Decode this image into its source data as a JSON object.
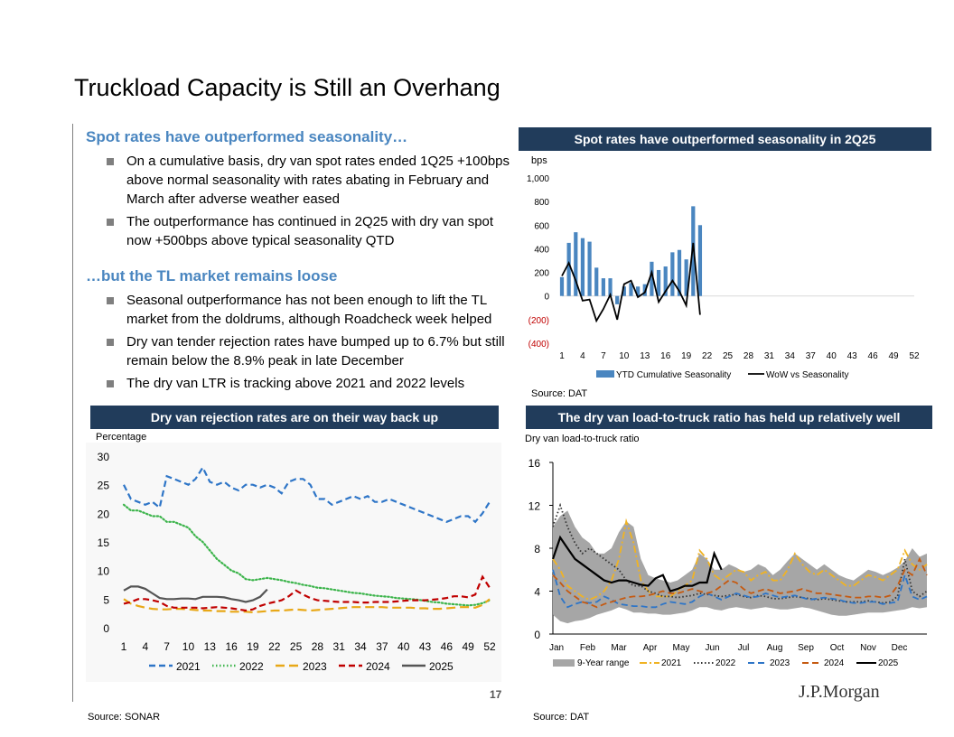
{
  "page": {
    "title": "Truckload Capacity is Still an Overhang",
    "page_number": "17",
    "logo": "J.P.Morgan"
  },
  "left": {
    "section1_heading": "Spot rates have outperformed seasonality…",
    "section1_bullets": [
      "On a cumulative basis, dry van spot rates ended 1Q25 +100bps above normal seasonality with rates abating in February and March after adverse weather eased",
      "The outperformance has continued in 2Q25 with dry van spot now +500bps above typical seasonality QTD"
    ],
    "section2_heading": "…but the TL market remains loose",
    "section2_bullets": [
      "Seasonal outperformance has not been enough to lift the TL market from the doldrums, although Roadcheck week helped",
      "Dry van tender rejection rates have bumped up to 6.7% but still remain below the 8.9% peak in late December",
      "The dry van LTR is tracking above 2021 and 2022 levels"
    ]
  },
  "chart_data": [
    {
      "id": "spot",
      "type": "bar",
      "title": "Spot rates have outperformed seasonality in 2Q25",
      "ylabel": "bps",
      "ylim": [
        -400,
        1000
      ],
      "yticks": [
        1000,
        800,
        600,
        400,
        200,
        0,
        -200,
        -400
      ],
      "ytick_labels": [
        "1,000",
        "800",
        "600",
        "400",
        "200",
        "0",
        "(200)",
        "(400)"
      ],
      "negative_tick_color": "#c00000",
      "x": [
        1,
        2,
        3,
        4,
        5,
        6,
        7,
        8,
        9,
        10,
        11,
        12,
        13,
        14,
        15,
        16,
        17,
        18,
        19,
        20,
        21
      ],
      "xticks": [
        1,
        4,
        7,
        10,
        13,
        16,
        19,
        22,
        25,
        28,
        31,
        34,
        37,
        40,
        43,
        46,
        49,
        52
      ],
      "xlim": [
        1,
        52
      ],
      "source": "Source: DAT",
      "series": [
        {
          "name": "YTD Cumulative Seasonality",
          "kind": "bar",
          "color": "#4a86c0",
          "values": [
            160,
            450,
            540,
            490,
            460,
            240,
            150,
            150,
            -70,
            80,
            110,
            80,
            100,
            290,
            220,
            250,
            370,
            390,
            310,
            760,
            600
          ]
        },
        {
          "name": "WoW vs Seasonality",
          "kind": "line",
          "color": "#000000",
          "values": [
            170,
            280,
            130,
            -40,
            -30,
            -210,
            -110,
            10,
            -200,
            100,
            130,
            -10,
            30,
            200,
            -50,
            40,
            130,
            40,
            -80,
            450,
            -160
          ]
        }
      ]
    },
    {
      "id": "rejection",
      "type": "line",
      "title": "Dry van rejection rates are on their way back up",
      "ylabel": "Percentage",
      "ylim": [
        0,
        30
      ],
      "yticks": [
        0,
        5,
        10,
        15,
        20,
        25,
        30
      ],
      "xlim": [
        1,
        52
      ],
      "xticks": [
        1,
        4,
        7,
        10,
        13,
        16,
        19,
        22,
        25,
        28,
        31,
        34,
        37,
        40,
        43,
        46,
        49,
        52
      ],
      "source": "Source: SONAR",
      "series": [
        {
          "name": "2021",
          "color": "#2e75c7",
          "dash": "dash",
          "values": [
            25.0,
            22.5,
            22.0,
            21.5,
            22.0,
            21.0,
            26.5,
            26.0,
            25.5,
            25.0,
            26.0,
            28.0,
            25.5,
            25.0,
            25.5,
            24.5,
            24.0,
            25.0,
            25.0,
            24.5,
            25.0,
            24.5,
            23.5,
            25.5,
            26.0,
            26.0,
            25.0,
            22.5,
            22.5,
            21.5,
            22.0,
            22.5,
            23.0,
            22.5,
            23.0,
            22.0,
            22.0,
            22.5,
            22.0,
            21.5,
            21.0,
            20.5,
            20.0,
            19.5,
            19.0,
            18.5,
            19.0,
            19.5,
            19.5,
            18.5,
            20.0,
            22.0
          ]
        },
        {
          "name": "2022",
          "color": "#3cb44b",
          "dash": "dot",
          "values": [
            21.5,
            20.5,
            20.5,
            20.0,
            19.5,
            19.5,
            18.5,
            18.5,
            18.0,
            17.5,
            16.0,
            15.0,
            13.5,
            12.0,
            11.0,
            10.0,
            9.5,
            8.5,
            8.3,
            8.5,
            8.7,
            8.5,
            8.3,
            8.0,
            7.8,
            7.5,
            7.3,
            7.0,
            6.9,
            6.7,
            6.5,
            6.3,
            6.1,
            6.0,
            5.8,
            5.6,
            5.5,
            5.4,
            5.2,
            5.1,
            5.0,
            4.9,
            4.7,
            4.5,
            4.4,
            4.2,
            4.1,
            4.0,
            3.9,
            4.0,
            4.3,
            4.8
          ]
        },
        {
          "name": "2023",
          "color": "#e8a817",
          "dash": "longdash",
          "values": [
            5.0,
            4.2,
            3.8,
            3.5,
            3.3,
            3.2,
            3.2,
            3.3,
            3.3,
            3.2,
            3.1,
            3.0,
            3.0,
            2.9,
            2.9,
            2.8,
            2.8,
            2.8,
            2.7,
            2.8,
            2.9,
            3.0,
            3.0,
            3.1,
            3.2,
            3.1,
            3.0,
            3.1,
            3.2,
            3.3,
            3.4,
            3.5,
            3.6,
            3.6,
            3.6,
            3.6,
            3.6,
            3.5,
            3.5,
            3.5,
            3.5,
            3.4,
            3.4,
            3.3,
            3.3,
            3.4,
            3.5,
            3.6,
            3.6,
            3.5,
            4.0,
            5.0
          ]
        },
        {
          "name": "2024",
          "color": "#c00000",
          "dash": "dash",
          "values": [
            4.2,
            4.5,
            5.0,
            5.0,
            4.8,
            4.5,
            3.8,
            3.5,
            3.5,
            3.5,
            3.5,
            3.4,
            3.5,
            3.6,
            3.5,
            3.4,
            3.2,
            3.0,
            3.2,
            3.8,
            4.2,
            4.5,
            4.8,
            5.5,
            6.5,
            5.8,
            5.2,
            4.8,
            4.7,
            4.6,
            4.5,
            4.5,
            4.5,
            4.4,
            4.4,
            4.5,
            4.5,
            4.5,
            4.6,
            4.7,
            4.8,
            4.8,
            4.8,
            4.9,
            5.0,
            5.2,
            5.5,
            5.5,
            5.3,
            5.8,
            8.9,
            7.0
          ]
        },
        {
          "name": "2025",
          "color": "#555555",
          "dash": "solid",
          "values": [
            6.5,
            7.2,
            7.2,
            6.8,
            6.0,
            5.2,
            5.0,
            5.0,
            5.1,
            5.1,
            5.0,
            5.4,
            5.4,
            5.4,
            5.3,
            5.0,
            4.8,
            4.5,
            4.8,
            5.4,
            6.7
          ]
        }
      ]
    },
    {
      "id": "ltr",
      "type": "line",
      "title": "The dry van load-to-truck ratio has held up relatively well",
      "ylabel": "Dry van load-to-truck ratio",
      "ylim": [
        0,
        16
      ],
      "yticks": [
        0,
        4,
        8,
        12,
        16
      ],
      "months": [
        "Jan",
        "Feb",
        "Mar",
        "Apr",
        "May",
        "Jun",
        "Jul",
        "Aug",
        "Sep",
        "Oct",
        "Nov",
        "Dec"
      ],
      "xlim": [
        1,
        52
      ],
      "source": "Source: DAT",
      "range": {
        "name": "9-Year range",
        "color": "#a6a6a6",
        "upper": [
          10.0,
          11.0,
          11.5,
          10.0,
          9.0,
          8.5,
          7.5,
          7.5,
          8.0,
          9.5,
          10.5,
          10.0,
          7.0,
          5.5,
          5.2,
          5.0,
          4.8,
          5.0,
          5.5,
          6.0,
          7.5,
          7.0,
          6.0,
          6.0,
          6.5,
          6.2,
          5.8,
          6.0,
          6.5,
          6.2,
          5.5,
          6.0,
          6.8,
          7.5,
          7.0,
          6.5,
          6.0,
          6.5,
          6.0,
          5.5,
          5.2,
          5.0,
          5.5,
          6.0,
          5.8,
          5.5,
          5.8,
          6.2,
          6.8,
          8.0,
          7.2,
          7.5
        ],
        "lower": [
          1.8,
          1.2,
          1.0,
          1.2,
          1.3,
          1.5,
          1.8,
          2.0,
          2.2,
          2.5,
          2.3,
          2.0,
          2.0,
          1.9,
          1.9,
          1.8,
          1.8,
          1.9,
          2.0,
          2.2,
          2.5,
          2.5,
          2.3,
          2.2,
          2.4,
          2.5,
          2.4,
          2.3,
          2.4,
          2.5,
          2.4,
          2.3,
          2.3,
          2.4,
          2.5,
          2.4,
          2.2,
          2.0,
          1.8,
          1.7,
          1.7,
          1.8,
          1.9,
          2.0,
          2.0,
          2.0,
          2.1,
          2.2,
          2.3,
          2.5,
          2.4,
          2.5
        ]
      },
      "series": [
        {
          "name": "2021",
          "color": "#f0b323",
          "dash": "dashdot",
          "values": [
            7.0,
            6.0,
            4.5,
            4.0,
            3.5,
            3.2,
            3.5,
            4.0,
            5.0,
            7.0,
            10.5,
            8.5,
            5.0,
            4.0,
            3.5,
            3.5,
            3.5,
            4.0,
            4.5,
            5.0,
            7.8,
            7.0,
            5.5,
            5.0,
            5.5,
            6.0,
            5.8,
            5.0,
            5.5,
            5.8,
            5.0,
            5.0,
            6.0,
            7.5,
            6.5,
            5.8,
            5.5,
            6.0,
            5.5,
            5.0,
            4.5,
            4.5,
            5.0,
            5.5,
            5.3,
            5.0,
            5.5,
            6.0,
            7.8,
            6.5,
            6.0,
            6.5
          ]
        },
        {
          "name": "2022",
          "color": "#333333",
          "dash": "dot",
          "values": [
            10.0,
            12.0,
            10.0,
            8.5,
            7.5,
            8.0,
            7.5,
            7.0,
            6.5,
            6.0,
            5.0,
            4.5,
            4.5,
            4.0,
            3.8,
            3.5,
            3.5,
            3.4,
            3.5,
            3.6,
            3.8,
            3.7,
            3.6,
            3.5,
            3.6,
            3.7,
            3.5,
            3.4,
            3.6,
            3.5,
            3.3,
            3.3,
            3.4,
            3.5,
            3.4,
            3.3,
            3.2,
            3.3,
            3.2,
            3.1,
            3.0,
            3.0,
            3.0,
            3.1,
            3.0,
            2.9,
            3.0,
            3.5,
            7.0,
            4.0,
            3.5,
            4.0
          ]
        },
        {
          "name": "2023",
          "color": "#2e75c7",
          "dash": "dash",
          "values": [
            6.0,
            3.5,
            2.5,
            2.8,
            3.0,
            2.9,
            3.0,
            3.5,
            3.2,
            2.8,
            2.7,
            2.6,
            2.6,
            2.5,
            2.5,
            2.8,
            3.0,
            2.9,
            2.8,
            3.0,
            3.5,
            3.8,
            3.5,
            3.2,
            3.5,
            3.8,
            3.6,
            3.4,
            3.5,
            3.8,
            3.6,
            3.4,
            3.5,
            3.6,
            3.4,
            3.2,
            3.3,
            3.4,
            3.3,
            3.2,
            3.0,
            2.9,
            2.9,
            3.0,
            3.0,
            2.8,
            2.9,
            3.0,
            5.5,
            3.5,
            3.2,
            3.5
          ]
        },
        {
          "name": "2024",
          "color": "#c55a11",
          "dash": "dash",
          "values": [
            5.5,
            4.8,
            4.0,
            3.5,
            3.0,
            2.8,
            2.5,
            2.8,
            3.0,
            3.2,
            3.4,
            3.5,
            3.5,
            3.6,
            3.8,
            4.0,
            3.8,
            3.8,
            4.0,
            4.2,
            4.0,
            3.8,
            4.0,
            4.5,
            5.0,
            4.8,
            4.2,
            3.8,
            4.0,
            4.2,
            4.0,
            3.8,
            3.9,
            4.0,
            4.2,
            4.0,
            3.8,
            3.8,
            3.7,
            3.6,
            3.5,
            3.4,
            3.4,
            3.5,
            3.5,
            3.4,
            3.6,
            4.5,
            6.0,
            5.5,
            7.0,
            5.5
          ]
        },
        {
          "name": "2025",
          "color": "#000000",
          "dash": "solid",
          "values": [
            7.0,
            9.0,
            8.0,
            7.0,
            6.5,
            6.0,
            5.5,
            5.0,
            4.8,
            5.0,
            5.0,
            4.8,
            4.6,
            4.5,
            5.2,
            5.5,
            4.0,
            4.2,
            4.5,
            4.5,
            4.8,
            4.8,
            7.5,
            6.0
          ]
        }
      ]
    }
  ]
}
